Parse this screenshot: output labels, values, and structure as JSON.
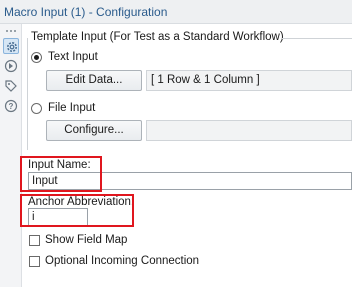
{
  "window": {
    "title": "Macro Input (1) - Configuration"
  },
  "sidebar": {
    "icons": [
      {
        "name": "gear-icon",
        "active": true
      },
      {
        "name": "workflow-connector-icon",
        "active": false
      },
      {
        "name": "tag-icon",
        "active": false
      },
      {
        "name": "help-icon",
        "active": false
      }
    ]
  },
  "template_input": {
    "group_label": "Template Input (For Test as a Standard Workflow)",
    "text_input": {
      "label": "Text Input",
      "selected": true,
      "button_label": "Edit Data...",
      "summary": "[ 1 Row & 1 Column ]"
    },
    "file_input": {
      "label": "File Input",
      "selected": false,
      "button_label": "Configure...",
      "path": ""
    }
  },
  "input_name": {
    "label": "Input Name:",
    "value": "Input"
  },
  "anchor_abbreviation": {
    "label": "Anchor Abbreviation:",
    "value": "i"
  },
  "options": {
    "show_field_map": {
      "label": "Show Field Map",
      "checked": false
    },
    "optional_incoming_connection": {
      "label": "Optional Incoming Connection",
      "checked": false
    }
  },
  "colors": {
    "title_text": "#2a5b8c",
    "highlight": "#e0161e",
    "active_icon_bg": "#d6e6f5"
  }
}
